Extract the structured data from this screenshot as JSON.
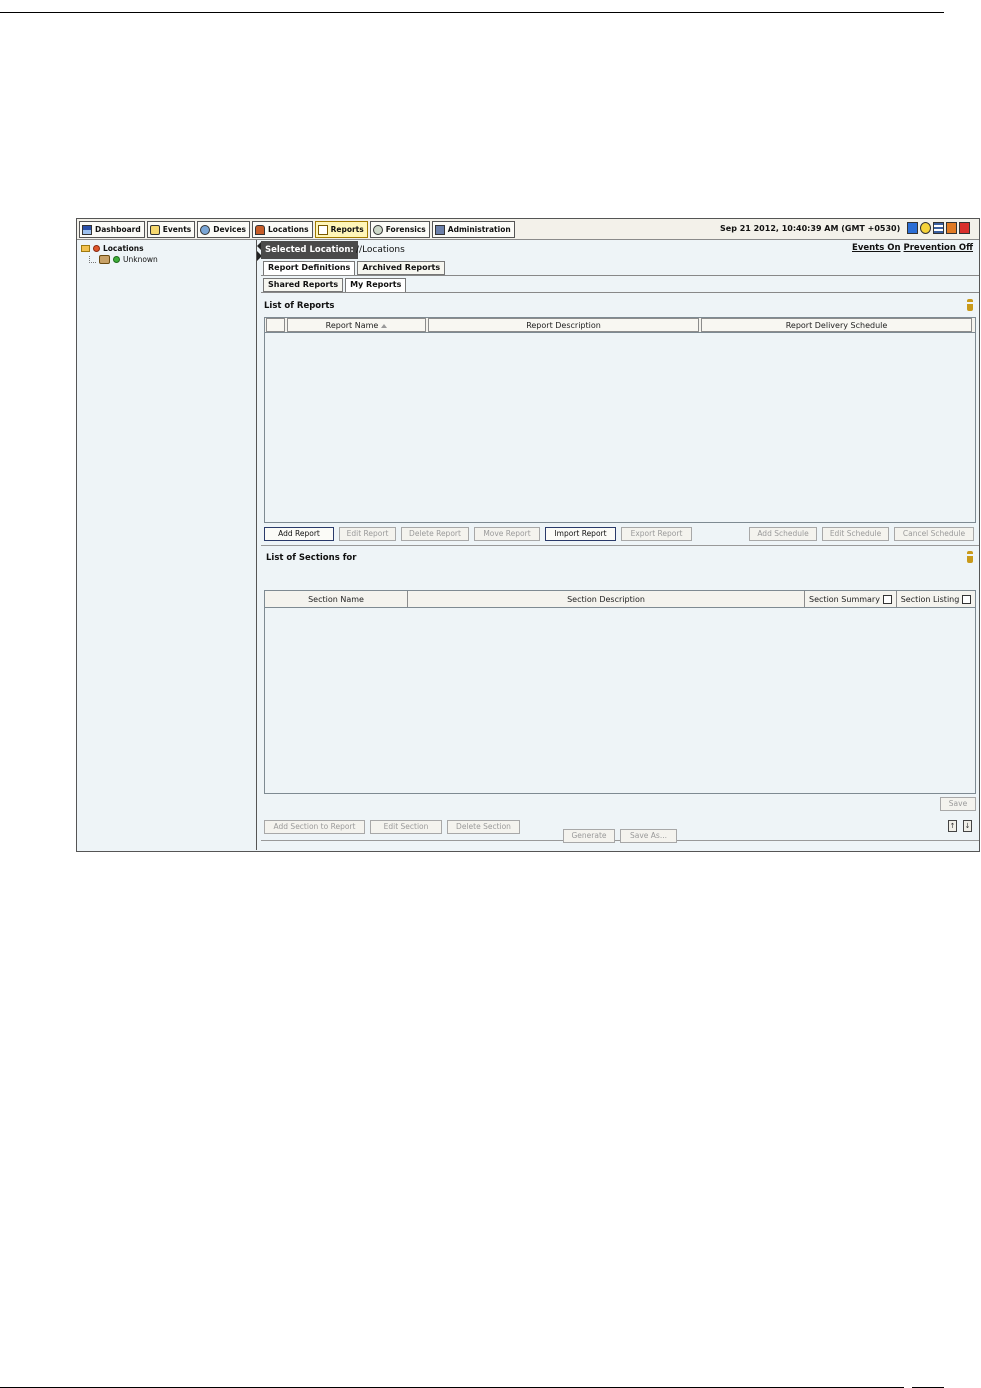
{
  "nav": {
    "tabs": [
      {
        "label": "Dashboard",
        "icon": "dashboard-icon"
      },
      {
        "label": "Events",
        "icon": "events-icon"
      },
      {
        "label": "Devices",
        "icon": "devices-icon"
      },
      {
        "label": "Locations",
        "icon": "locations-icon"
      },
      {
        "label": "Reports",
        "icon": "reports-icon",
        "active": true
      },
      {
        "label": "Forensics",
        "icon": "forensics-icon"
      },
      {
        "label": "Administration",
        "icon": "administration-icon"
      }
    ],
    "datetime": "Sep 21 2012, 10:40:39 AM (GMT +0530)"
  },
  "tree": {
    "root": "Locations",
    "child": "Unknown"
  },
  "location": {
    "label": "Selected Location:",
    "path": "//Locations",
    "events_on": "Events On",
    "prevention_off": "Prevention Off"
  },
  "tabs": {
    "report_definitions": "Report Definitions",
    "archived_reports": "Archived Reports",
    "shared_reports": "Shared Reports",
    "my_reports": "My Reports"
  },
  "reports": {
    "title": "List of Reports",
    "columns": [
      "Report Name",
      "Report Description",
      "Report Delivery Schedule"
    ],
    "buttons": {
      "add": "Add Report",
      "edit": "Edit Report",
      "delete": "Delete Report",
      "move": "Move Report",
      "import": "Import Report",
      "export": "Export Report",
      "add_schedule": "Add Schedule",
      "edit_schedule": "Edit Schedule",
      "cancel_schedule": "Cancel Schedule"
    }
  },
  "sections": {
    "title": "List of Sections for",
    "columns": {
      "name": "Section Name",
      "description": "Section Description",
      "summary": "Section Summary",
      "listing": "Section Listing"
    },
    "buttons": {
      "save": "Save",
      "add": "Add Section to Report",
      "edit": "Edit Section",
      "delete": "Delete Section"
    }
  },
  "footer": {
    "generate": "Generate",
    "save_as": "Save As..."
  }
}
